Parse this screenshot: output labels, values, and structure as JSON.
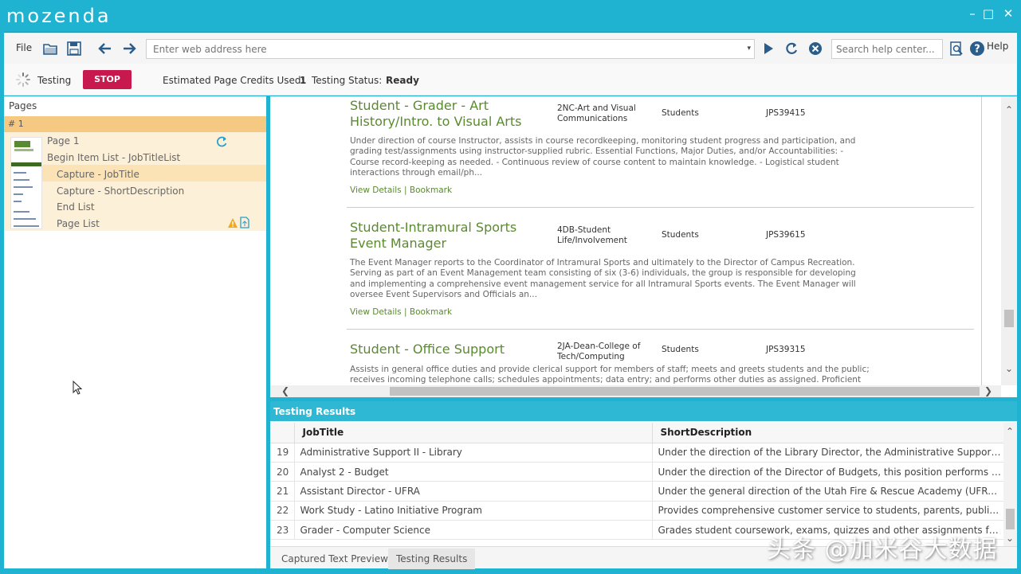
{
  "app": {
    "logo": "mozenda"
  },
  "toolbar": {
    "file_label": "File",
    "address_placeholder": "Enter web address here",
    "search_placeholder": "Search help center...",
    "help_label": "Help"
  },
  "status": {
    "testing_label": "Testing",
    "stop_label": "STOP",
    "credits_label": "Estimated Page Credits Used:",
    "credits_value": "1",
    "testing_status_label": "Testing Status:",
    "testing_status_value": "Ready"
  },
  "pages": {
    "header": "Pages",
    "group": "# 1",
    "items": [
      "Page 1",
      "Begin Item List - JobTitleList",
      "Capture - JobTitle",
      "Capture - ShortDescription",
      "End List",
      "Page List"
    ]
  },
  "jobs": [
    {
      "title": "Student - Grader - Art History/Intro. to Visual Arts",
      "dept": "2NC-Art and Visual Communications",
      "audience": "Students",
      "code": "JPS39415",
      "desc": "Under direction of course Instructor, assists in course recordkeeping, monitoring student progress and participation, and grading test/assignments using instructor-supplied rubric. Essential Functions, Major Duties, and/or Accountabilities: - Course record-keeping as needed. - Continuous review of course content to maintain knowledge. - Logistical student interactions through email/ph...",
      "links": "View Details | Bookmark"
    },
    {
      "title": "Student-Intramural Sports Event Manager",
      "dept": "4DB-Student Life/Involvement",
      "audience": "Students",
      "code": "JPS39615",
      "desc": "The Event Manager reports to the Coordinator of Intramural Sports and ultimately to the Director of Campus Recreation. Serving as part of an Event Management team consisting of six (3-6) individuals, the group is responsible for developing and implementing a comprehensive event management service for all Intramural Sports events. The Event Manager will oversee Event Supervisors and Officials an...",
      "links": "View Details | Bookmark"
    },
    {
      "title": "Student - Office Support",
      "dept": "2JA-Dean-College of Tech/Computing",
      "audience": "Students",
      "code": "JPS39315",
      "desc": "Assists in general office duties and provide clerical support for members of staff; meets and greets students and the public; receives incoming telephone calls; schedules appointments; data entry; and performs other duties as assigned. Proficient use in operating",
      "links": ""
    }
  ],
  "results": {
    "header": "Testing Results",
    "columns": [
      "",
      "JobTitle",
      "ShortDescription"
    ],
    "rows": [
      [
        "19",
        "Administrative Support II - Library",
        "Under the direction of the Library Director, the Administrative Support II per..."
      ],
      [
        "20",
        "Analyst 2 - Budget",
        "Under the direction of the Director of Budgets, this position performs a vari..."
      ],
      [
        "21",
        "Assistant Director - UFRA",
        "Under the general direction of the Utah Fire & Rescue Academy (UFRA) Dire..."
      ],
      [
        "22",
        "Work Study - Latino Initiative Program",
        "Provides comprehensive customer service to students, parents, public, and ..."
      ],
      [
        "23",
        "Grader - Computer Science",
        "Grades student coursework, exams, quizzes and other assignments for facul..."
      ]
    ],
    "tabs": [
      "Captured Text Preview",
      "Testing Results"
    ]
  },
  "watermark": "头条 @加米谷大数据",
  "colors": {
    "accent": "#1fb3d1",
    "stop": "#c8194f",
    "job_title": "#5a8a2f",
    "group": "#f6c983"
  }
}
